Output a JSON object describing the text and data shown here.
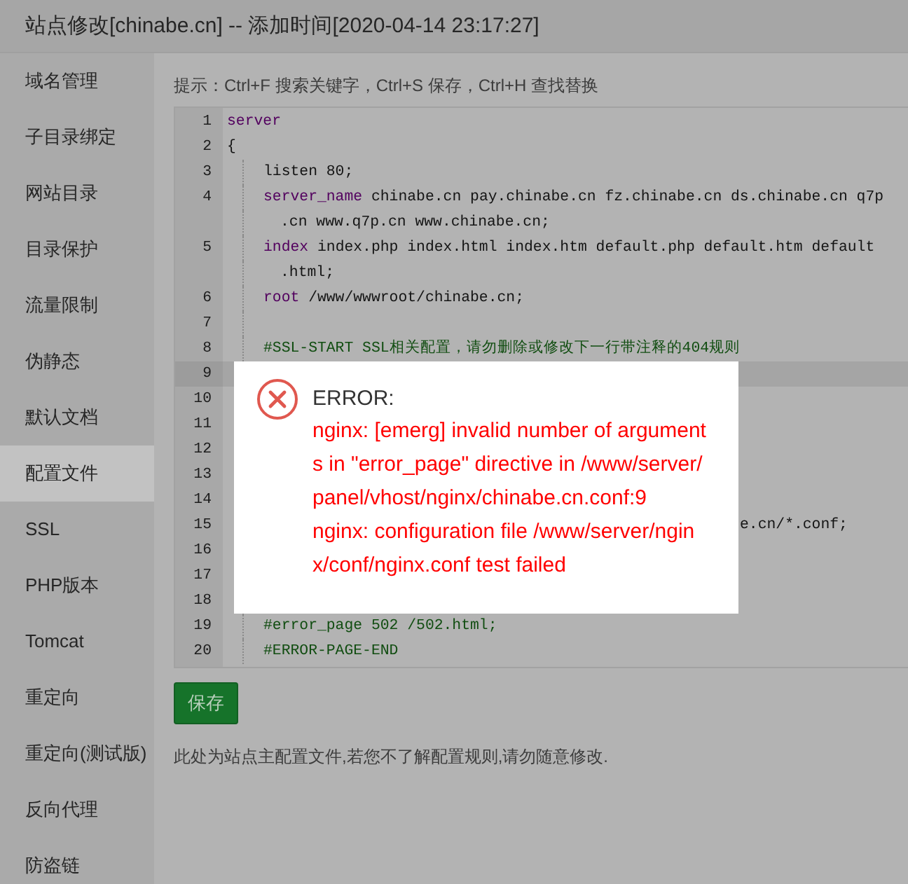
{
  "window": {
    "title": "站点修改[chinabe.cn] -- 添加时间[2020-04-14 23:17:27]"
  },
  "sidebar": {
    "items": [
      {
        "label": "域名管理",
        "selected": false
      },
      {
        "label": "子目录绑定",
        "selected": false
      },
      {
        "label": "网站目录",
        "selected": false
      },
      {
        "label": "目录保护",
        "selected": false
      },
      {
        "label": "流量限制",
        "selected": false
      },
      {
        "label": "伪静态",
        "selected": false
      },
      {
        "label": "默认文档",
        "selected": false
      },
      {
        "label": "配置文件",
        "selected": true
      },
      {
        "label": "SSL",
        "selected": false
      },
      {
        "label": "PHP版本",
        "selected": false
      },
      {
        "label": "Tomcat",
        "selected": false
      },
      {
        "label": "重定向",
        "selected": false
      },
      {
        "label": "重定向(测试版)",
        "selected": false
      },
      {
        "label": "反向代理",
        "selected": false
      },
      {
        "label": "防盗链",
        "selected": false
      }
    ]
  },
  "hint": "提示：Ctrl+F 搜索关键字，Ctrl+S 保存，Ctrl+H 查找替换",
  "editor": {
    "lines": [
      {
        "number": "1",
        "active": false,
        "indent": false,
        "parts": [
          {
            "kind": "keyword",
            "text": "server"
          }
        ]
      },
      {
        "number": "2",
        "active": false,
        "indent": false,
        "parts": [
          {
            "kind": "plain",
            "text": "{"
          }
        ]
      },
      {
        "number": "3",
        "active": false,
        "indent": true,
        "parts": [
          {
            "kind": "plain",
            "text": "listen 80;"
          }
        ]
      },
      {
        "number": "4",
        "active": false,
        "indent": true,
        "parts": [
          {
            "kind": "keyword",
            "text": "server_name"
          },
          {
            "kind": "plain",
            "text": " chinabe.cn pay.chinabe.cn fz.chinabe.cn ds.chinabe.cn q7p"
          }
        ],
        "wrap": ".cn www.q7p.cn www.chinabe.cn;"
      },
      {
        "number": "5",
        "active": false,
        "indent": true,
        "parts": [
          {
            "kind": "keyword",
            "text": "index"
          },
          {
            "kind": "plain",
            "text": " index.php index.html index.htm default.php default.htm default"
          }
        ],
        "wrap": ".html;"
      },
      {
        "number": "6",
        "active": false,
        "indent": true,
        "parts": [
          {
            "kind": "keyword",
            "text": "root"
          },
          {
            "kind": "plain",
            "text": " /www/wwwroot/chinabe.cn;"
          }
        ]
      },
      {
        "number": "7",
        "active": false,
        "indent": true
      },
      {
        "number": "8",
        "active": false,
        "indent": true,
        "parts": [
          {
            "kind": "comment",
            "text": "#SSL-START SSL相关配置，请勿删除或修改下一行带注释的404规则"
          }
        ]
      },
      {
        "number": "9",
        "active": true
      },
      {
        "number": "10",
        "active": false
      },
      {
        "number": "11",
        "active": false
      },
      {
        "number": "12",
        "active": false
      },
      {
        "number": "13",
        "active": false
      },
      {
        "number": "14",
        "active": false
      },
      {
        "number": "15",
        "active": false,
        "parts": [
          {
            "kind": "fragment",
            "text": "e.cn/*.conf;"
          }
        ]
      },
      {
        "number": "16",
        "active": false
      },
      {
        "number": "17",
        "active": false
      },
      {
        "number": "18",
        "active": false
      },
      {
        "number": "19",
        "active": false,
        "indent": true,
        "parts": [
          {
            "kind": "comment",
            "text": "#error_page 502 /502.html;"
          }
        ]
      },
      {
        "number": "20",
        "active": false,
        "indent": true,
        "parts": [
          {
            "kind": "comment",
            "text": "#ERROR-PAGE-END"
          }
        ]
      }
    ]
  },
  "save_button": "保存",
  "note": "此处为站点主配置文件,若您不了解配置规则,请勿随意修改.",
  "dialog": {
    "title": "ERROR:",
    "messages": [
      "nginx: [emerg] invalid number of arguments in \"error_page\" directive in /www/server/panel/vhost/nginx/chinabe.cn.conf:9",
      "nginx: configuration file /www/server/nginx/conf/nginx.conf test failed"
    ]
  }
}
